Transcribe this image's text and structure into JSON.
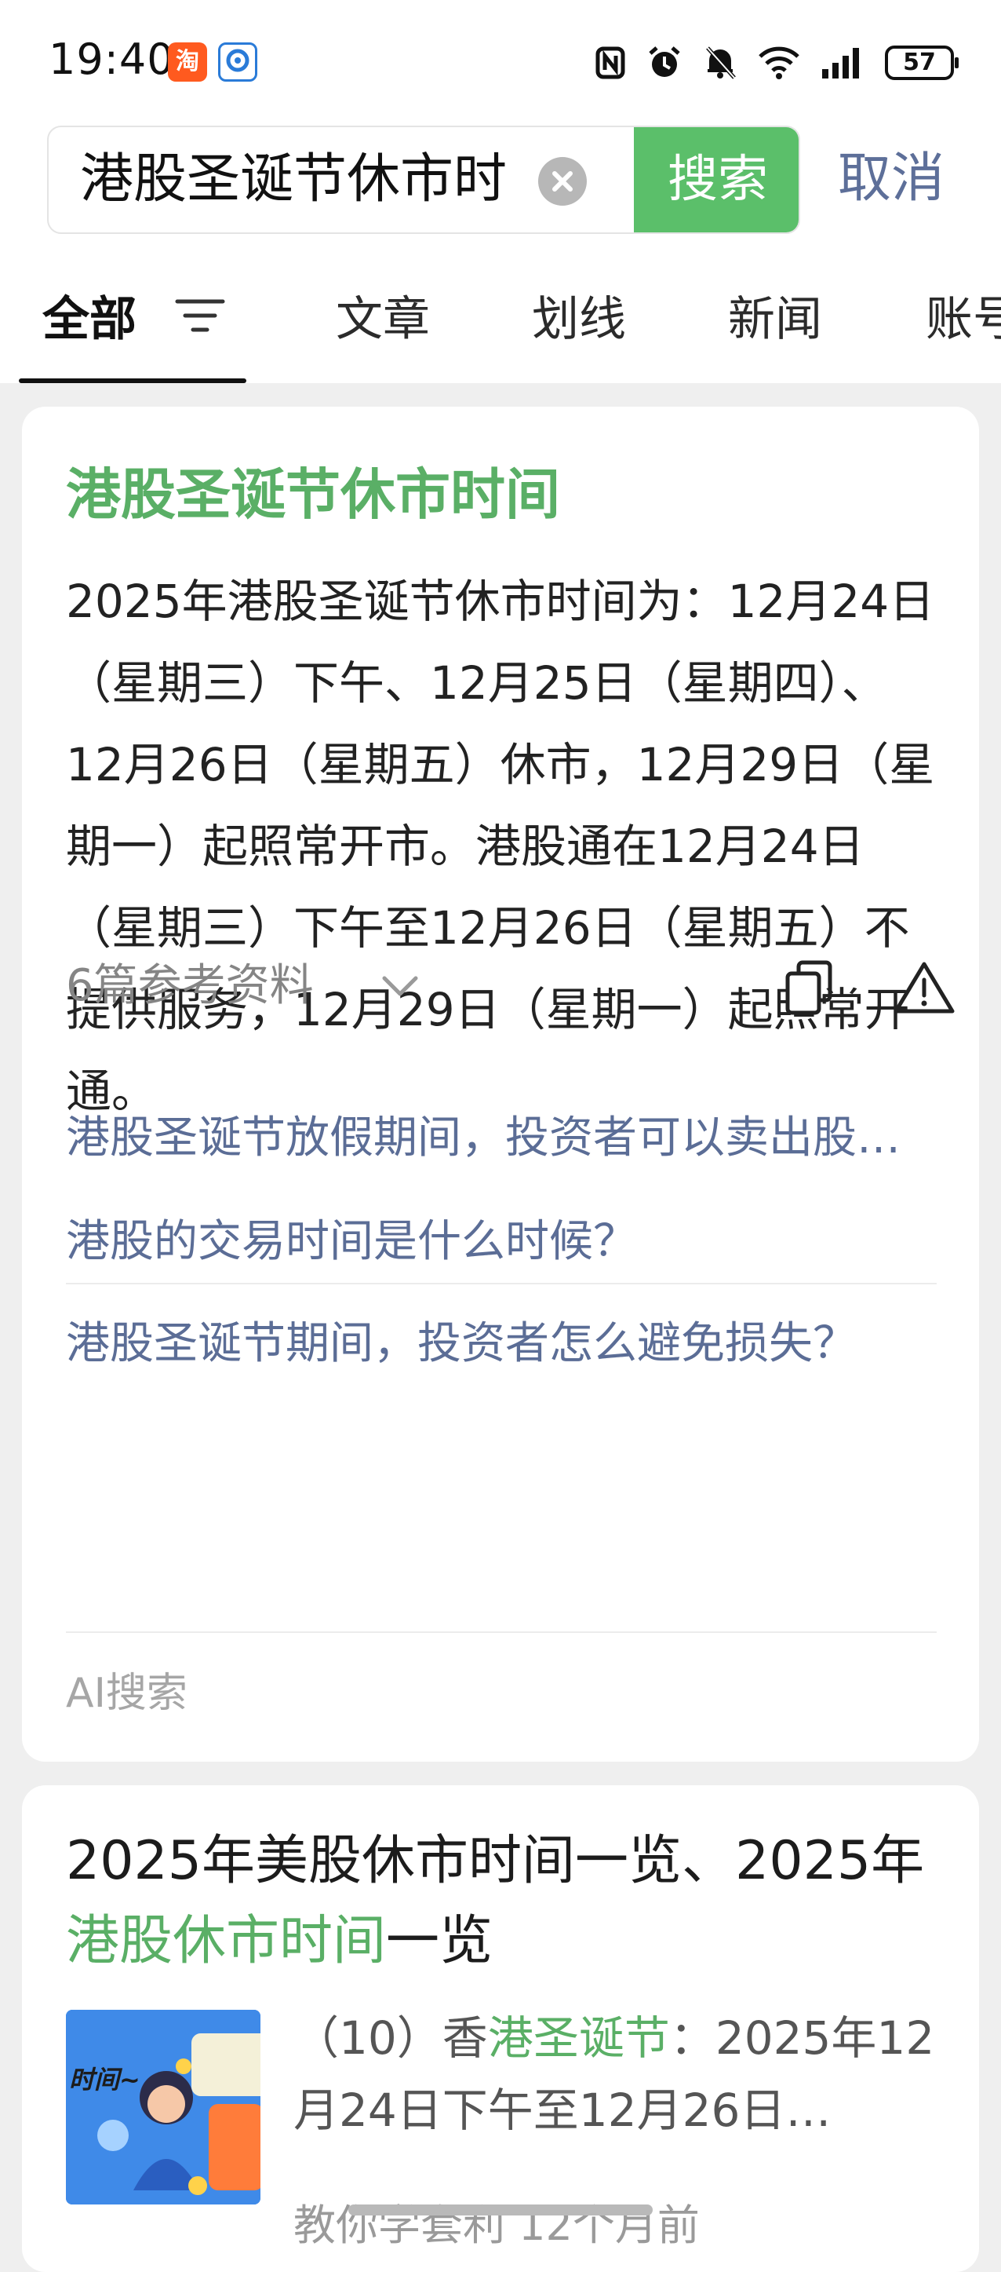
{
  "status_bar": {
    "time": "19:40",
    "app_badge_1": "淘",
    "battery": "57",
    "icons": [
      "nfc-icon",
      "alarm-icon",
      "mute-bell-icon",
      "wifi-icon",
      "cellular-signal-icon",
      "battery-icon"
    ]
  },
  "search": {
    "query": "港股圣诞节休市时",
    "button_label": "搜索",
    "cancel_label": "取消"
  },
  "tabs": [
    {
      "label": "全部",
      "active": true
    },
    {
      "label": "文章"
    },
    {
      "label": "划线"
    },
    {
      "label": "新闻"
    },
    {
      "label": "账号"
    }
  ],
  "ai_card": {
    "title": "港股圣诞节休市时间",
    "answer": "2025年港股圣诞节休市时间为：12月24日（星期三）下午、12月25日（星期四）、12月26日（星期五）休市，12月29日（星期一）起照常开市。港股通在12月24日（星期三）下午至12月26日（星期五）不提供服务，12月29日（星期一）起照常开通。",
    "references_label": "6篇参考资料",
    "related_questions": [
      "港股圣诞节放假期间，投资者可以卖出股票吗？",
      "港股的交易时间是什么时候？",
      "港股圣诞节期间，投资者怎么避免损失？"
    ],
    "footer": "AI搜索"
  },
  "result_card": {
    "title_parts": [
      "2025年美股休市时间一览、2025年",
      "港股休市时间",
      "一览"
    ],
    "snippet_parts": [
      "（10）香",
      "港圣诞节",
      "：2025年12月24日下午至12月26日…"
    ],
    "source": "教你学套利",
    "time_ago": "12个月前",
    "thumb_text": "时间~"
  },
  "colors": {
    "accent_green": "#5bbf6a",
    "highlight_green": "#5aaf66",
    "link_blue": "#5b6d96",
    "background": "#efefef"
  }
}
